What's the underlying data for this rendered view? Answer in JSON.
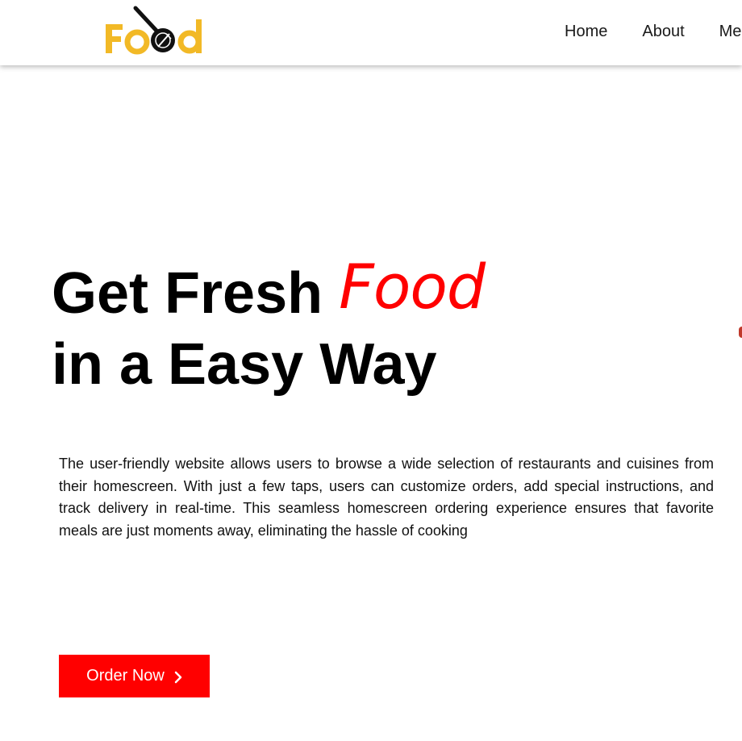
{
  "brand": {
    "logo_text": "Food",
    "logo_color": "#f2b926"
  },
  "nav": {
    "items": [
      "Home",
      "About",
      "Me"
    ]
  },
  "hero": {
    "title_part1": "Get Fresh",
    "title_accent": "Food",
    "title_line2": "in a Easy Way",
    "accent_color": "#ff0000"
  },
  "description": "The user-friendly website allows users to browse a wide selection of restaurants and cuisines from their homescreen. With just a few taps, users can customize orders, add special instructions, and track delivery in real-time. This seamless homescreen ordering experience ensures that favorite meals are just moments away, eliminating the hassle of cooking",
  "cta": {
    "label": "Order Now",
    "icon": "chevron-right-icon",
    "color": "#ff0000"
  }
}
